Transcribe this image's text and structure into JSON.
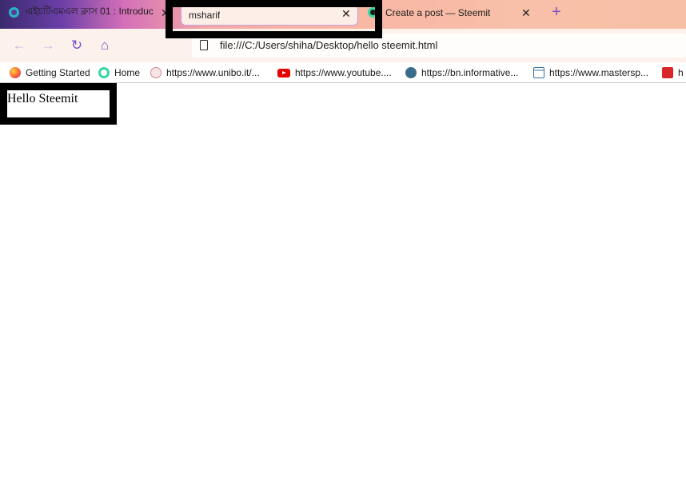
{
  "tabs": [
    {
      "title": "এইচটিএমএল ক্লাস 01 : Introduc",
      "favicon": "steemit-icon",
      "close": "✕"
    },
    {
      "title": "msharif",
      "close": "✕",
      "active": true
    },
    {
      "title": "Create a post — Steemit",
      "favicon": "steemit-icon",
      "close": "✕"
    }
  ],
  "new_tab": "+",
  "toolbar": {
    "back": "←",
    "forward": "→",
    "reload": "↻",
    "home": "⌂",
    "url": "file:///C:/Users/shiha/Desktop/hello steemit.html"
  },
  "bookmarks": [
    {
      "label": "Getting Started",
      "icon": "firefox-icon"
    },
    {
      "label": "Home",
      "icon": "steemit-icon"
    },
    {
      "label": "https://www.unibo.it/...",
      "icon": "unibo-icon"
    },
    {
      "label": "https://www.youtube....",
      "icon": "youtube-icon"
    },
    {
      "label": "https://bn.informative...",
      "icon": "wordpress-icon"
    },
    {
      "label": "https://www.mastersp...",
      "icon": "bank-icon"
    },
    {
      "label": "h",
      "icon": "red-logo-icon"
    }
  ],
  "page": {
    "text": "Hello Steemit"
  },
  "colors": {
    "accent": "#7b4fc8",
    "highlight": "#000000"
  }
}
